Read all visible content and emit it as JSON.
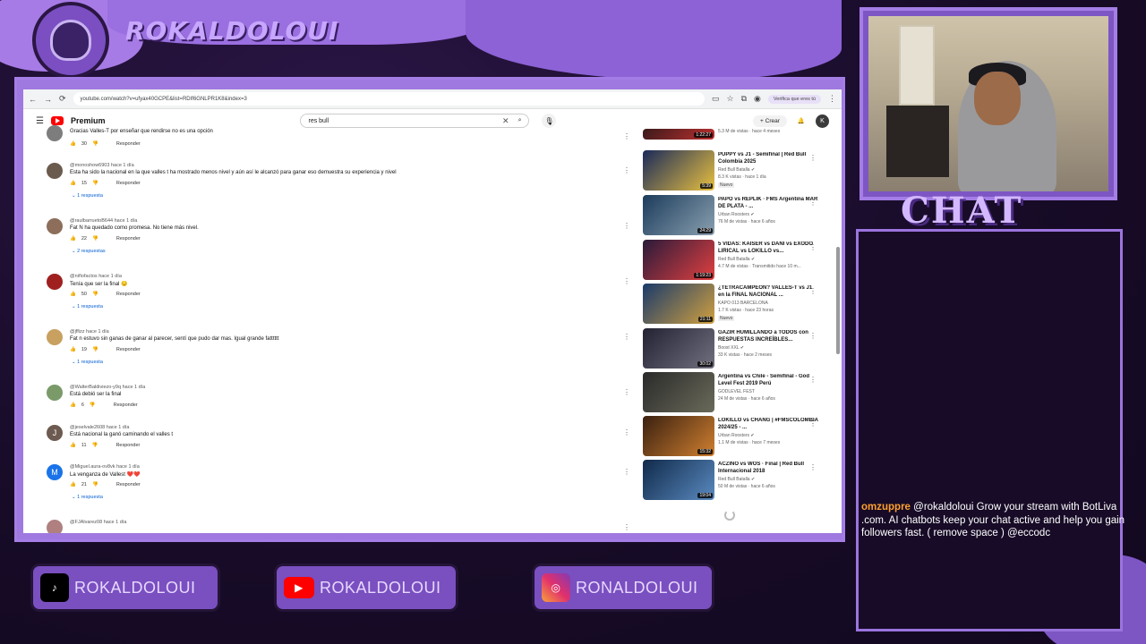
{
  "overlay": {
    "brand_name": "ROKALDOLOUI",
    "chat_title": "CHAT",
    "chat_message": {
      "user": "omzuppre",
      "text": "@rokaldoloui Grow your stream with BotLiva .com. AI chatbots keep your chat active and help you gain followers fast. ( remove space ) @eccodc"
    },
    "socials": [
      {
        "platform": "TikTok",
        "icon": "tiktok-icon",
        "label": "ROKALDOLOUI"
      },
      {
        "platform": "YouTube",
        "icon": "youtube-icon",
        "label": "ROKALDOLOUI"
      },
      {
        "platform": "Instagram",
        "icon": "instagram-icon",
        "label": "RONALDOLOUI"
      }
    ],
    "colors": {
      "accent": "#a47ee6",
      "background": "#1c0f2e",
      "chat_user": "#ff9f2e"
    }
  },
  "browser": {
    "url": "youtube.com/watch?v=ufyax40GCPE&list=RDIf6GNLPR1K8&index=3",
    "verify_label": "Verifica que eres tú"
  },
  "youtube": {
    "logo_text": "Premium",
    "search_query": "res bull",
    "create_label": "Crear",
    "avatar_letter": "K",
    "comments": [
      {
        "author": "",
        "time": "",
        "text": "Gracias Valles-T por enseñar que rendirse no es una opción",
        "likes": "30",
        "replies": "",
        "avatar_color": "#7d7d7d",
        "avatar_letter": ""
      },
      {
        "author": "@monoshow6903",
        "time": "hace 1 día",
        "text": "Esta ha sido la nacional en la que valles t ha mostrado menos nivel y aún así le alcanzó para ganar eso demuestra su experiencia y nivel",
        "likes": "15",
        "replies": "1 respuesta",
        "avatar_color": "#6b5b4e",
        "avatar_letter": ""
      },
      {
        "author": "@raulbarruetoB644",
        "time": "hace 1 día",
        "text": "Fat N ha quedado como promesa. No tiene más nivel.",
        "likes": "22",
        "replies": "2 respuestas",
        "avatar_color": "#8c6e5a",
        "avatar_letter": ""
      },
      {
        "author": "@niñofactos",
        "time": "hace 1 día",
        "text": "Tenía que ser la final 😔",
        "likes": "50",
        "replies": "1 respuesta",
        "avatar_color": "#a02020",
        "avatar_letter": ""
      },
      {
        "author": "@jffizz",
        "time": "hace 1 día",
        "text": "Fat n estuvo sin ganas de ganar al parecer, sentí que pudo dar mas. Igual grande fatttttt",
        "likes": "19",
        "replies": "1 respuesta",
        "avatar_color": "#c8a060",
        "avatar_letter": ""
      },
      {
        "author": "@WalterBaldiviezo-y9q",
        "time": "hace 1 día",
        "text": "Está debió ser la final",
        "likes": "6",
        "replies": "",
        "avatar_color": "#7a9a6a",
        "avatar_letter": ""
      },
      {
        "author": "@jeselvale2608",
        "time": "hace 1 día",
        "text": "Está nacional la ganó caminando el valles t",
        "likes": "11",
        "replies": "",
        "avatar_color": "#6d5a50",
        "avatar_letter": "J"
      },
      {
        "author": "@Miguel.aura-ov8vk",
        "time": "hace 1 día",
        "text": "La venganza de Vallest ❤️❤️",
        "likes": "21",
        "replies": "1 respuesta",
        "avatar_color": "#1a73e8",
        "avatar_letter": "M"
      },
      {
        "author": "@FJAlvarez08",
        "time": "hace 1 día",
        "text": "",
        "likes": "",
        "replies": "",
        "avatar_color": "#b08080",
        "avatar_letter": ""
      }
    ],
    "reply_label": "Responder",
    "recommendations": [
      {
        "title": "",
        "channel": "",
        "meta": "5.3 M de vistas · hace 4 meses",
        "duration": "1:22:27",
        "badge": "",
        "colors": [
          "#3a1a1a",
          "#c03030"
        ]
      },
      {
        "title": "PUPPY vs J1 - Semifinal | Red Bull Colombia 2025",
        "channel": "Red Bull Batalla ✔",
        "meta": "8.3 K vistas · hace 1 día",
        "duration": "5:39",
        "badge": "Nuevo",
        "colors": [
          "#1a2a5a",
          "#e8c040"
        ]
      },
      {
        "title": "PAPO vs REPLIK · FMS Argentina MAR DE PLATA - ...",
        "channel": "Urban Roosters ✔",
        "meta": "76 M de vistas · hace 6 años",
        "duration": "24:29",
        "badge": "",
        "colors": [
          "#1c3c5c",
          "#8aa0b0"
        ]
      },
      {
        "title": "5 VIDAS: KAISER vs DANI vs EXODO LIRICAL vs LOKILLO vs...",
        "channel": "Red Bull Batalla ✔",
        "meta": "4.7 M de vistas · Transmitido hace 10 m...",
        "duration": "1:19:23",
        "badge": "",
        "colors": [
          "#2a1a3a",
          "#e04040"
        ]
      },
      {
        "title": "¿TETRACAMPEÓN? VALLES-T vs J1 en la FINAL NACIONAL ...",
        "channel": "KAPO 013 BARCELONA",
        "meta": "1.7 K vistas · hace 23 horas",
        "duration": "21:11",
        "badge": "Nuevo",
        "colors": [
          "#1a3a6a",
          "#d0a040"
        ]
      },
      {
        "title": "GAZIR HUMILLANDO a TODOS con RESPUESTAS INCREÍBLES...",
        "channel": "Boost XXL ✔",
        "meta": "33 K vistas · hace 2 meses",
        "duration": "30:02",
        "badge": "",
        "colors": [
          "#222233",
          "#707080"
        ]
      },
      {
        "title": "Argentina vs Chile - Semifinal - God Level Fest 2019 Perú",
        "channel": "GODLEVEL FEST",
        "meta": "24 M de vistas · hace 6 años",
        "duration": "",
        "badge": "",
        "colors": [
          "#2a2a2a",
          "#6a6a5a"
        ]
      },
      {
        "title": "LOKILLO vs CHANG | #FMSCOLOMBIA 2024/25 - ...",
        "channel": "Urban Roosters ✔",
        "meta": "1.1 M de vistas · hace 7 meses",
        "duration": "15:32",
        "badge": "",
        "colors": [
          "#3a2010",
          "#d08030"
        ]
      },
      {
        "title": "ACZINO vs WOS · Final | Red Bull Internacional 2018",
        "channel": "Red Bull Batalla ✔",
        "meta": "50 M de vistas · hace 6 años",
        "duration": "19:04",
        "badge": "",
        "colors": [
          "#102a4a",
          "#5a8ac0"
        ]
      }
    ]
  }
}
